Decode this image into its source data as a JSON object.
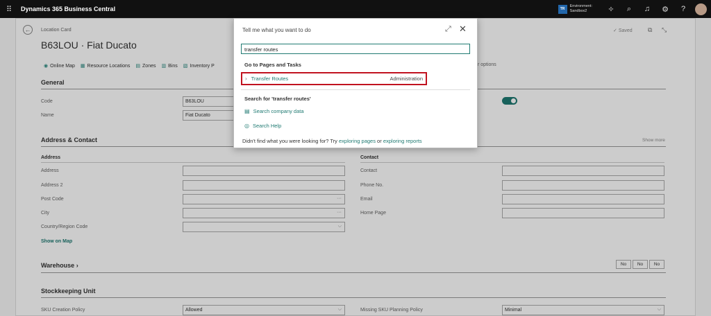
{
  "app": {
    "name": "Dynamics 365 Business Central",
    "environment_badge": "TR",
    "environment_label": "Environment:",
    "environment_name": "Sandbox2"
  },
  "page": {
    "breadcrumb": "Location Card",
    "title": "B63LOU · Fiat Ducato",
    "saved_label": "Saved",
    "actions": [
      {
        "label": "Online Map",
        "icon": "globe-icon"
      },
      {
        "label": "Resource Locations",
        "icon": "resource-icon"
      },
      {
        "label": "Zones",
        "icon": "zones-icon"
      },
      {
        "label": "Bins",
        "icon": "bins-icon"
      },
      {
        "label": "Inventory P",
        "icon": "inventory-icon"
      }
    ],
    "fewer_options": "wer options"
  },
  "general": {
    "title": "General",
    "code_label": "Code",
    "code_value": "B63LOU",
    "name_label": "Name",
    "name_value": "Fiat Ducato"
  },
  "address": {
    "title": "Address & Contact",
    "show_more": "Show more",
    "address_head": "Address",
    "contact_head": "Contact",
    "address_label": "Address",
    "address2_label": "Address 2",
    "postcode_label": "Post Code",
    "city_label": "City",
    "country_label": "Country/Region Code",
    "contact_label": "Contact",
    "phone_label": "Phone No.",
    "email_label": "Email",
    "homepage_label": "Home Page",
    "show_on_map": "Show on Map",
    "ellipsis": "···",
    "chevron": "⌵"
  },
  "warehouse": {
    "title": "Warehouse",
    "arrow": "›",
    "badges": [
      "No",
      "No",
      "No"
    ]
  },
  "sku": {
    "title": "Stockkeeping Unit",
    "creation_label": "SKU Creation Policy",
    "creation_value": "Allowed",
    "missing_label": "Missing SKU Planning Policy",
    "missing_value": "Minimal"
  },
  "dialog": {
    "title": "Tell me what you want to do",
    "search_value": "transfer routes",
    "section_pages": "Go to Pages and Tasks",
    "result_label": "Transfer Routes",
    "result_category": "Administration",
    "section_search": "Search for 'transfer routes'",
    "search_company": "Search company data",
    "search_help": "Search Help",
    "footer_prefix": "Didn't find what you were looking for? Try ",
    "footer_link1": "exploring pages",
    "footer_mid": " or ",
    "footer_link2": "exploring reports"
  }
}
